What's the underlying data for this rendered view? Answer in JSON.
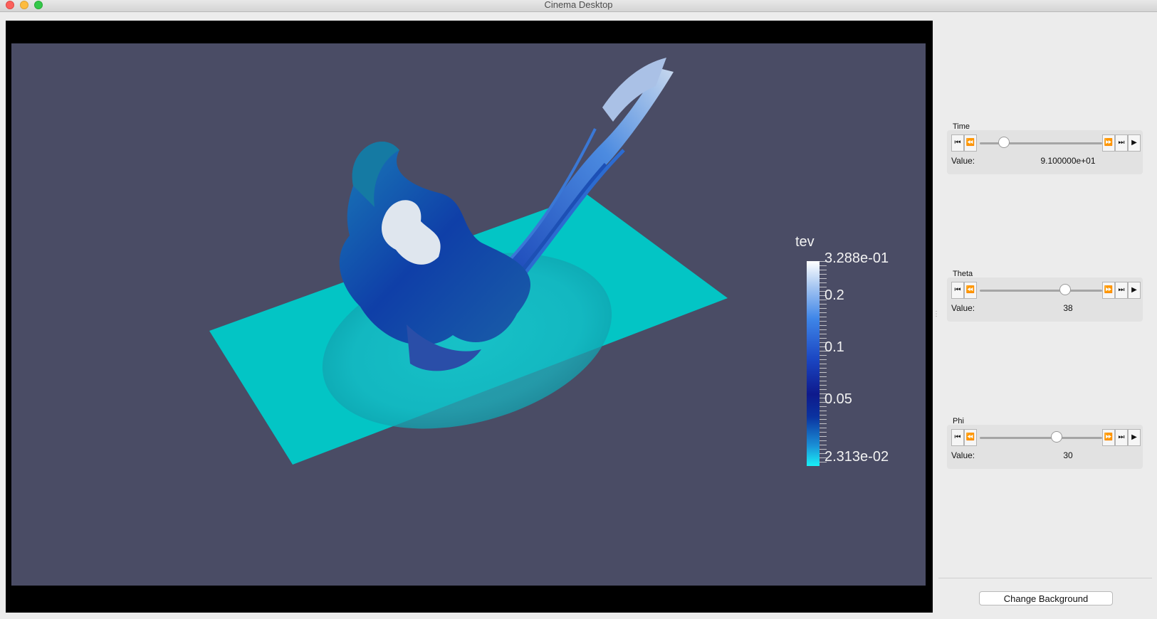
{
  "window": {
    "title": "Cinema Desktop"
  },
  "viewer": {
    "background_color": "#4a4c65",
    "colorbar": {
      "title": "tev",
      "labels": [
        "3.288e-01",
        "0.2",
        "0.1",
        "0.05",
        "2.313e-02"
      ]
    }
  },
  "controls": [
    {
      "name": "Time",
      "value_label": "Value:",
      "value": "9.100000e+01",
      "slider_fraction": 0.2
    },
    {
      "name": "Theta",
      "value_label": "Value:",
      "value": "38",
      "slider_fraction": 0.7
    },
    {
      "name": "Phi",
      "value_label": "Value:",
      "value": "30",
      "slider_fraction": 0.63
    }
  ],
  "buttons": {
    "change_background": "Change Background"
  },
  "icons": {
    "first": "skip-to-first-icon",
    "previous": "step-back-icon",
    "next": "step-forward-icon",
    "last": "skip-to-last-icon",
    "play": "play-icon"
  }
}
